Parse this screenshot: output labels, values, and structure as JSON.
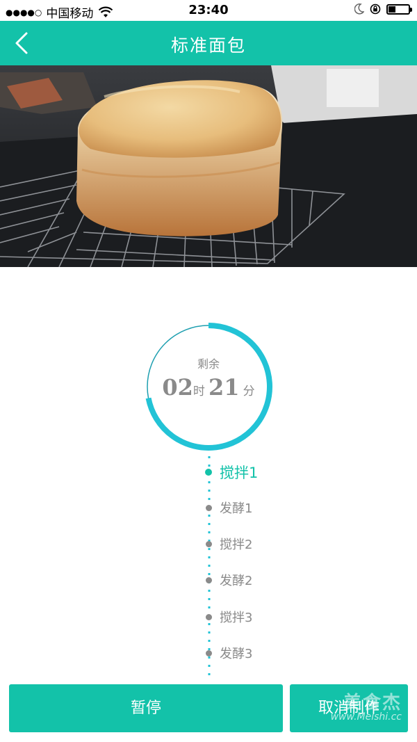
{
  "status_bar": {
    "signal": "●●●●○",
    "carrier": "中国移动",
    "time": "23:40"
  },
  "nav": {
    "title": "标准面包"
  },
  "timer": {
    "label": "剩余",
    "hours": "02",
    "hours_unit": "时",
    "minutes": "21",
    "minutes_unit": "分",
    "progress_fraction": 0.72
  },
  "steps": [
    {
      "label": "搅拌1",
      "active": true
    },
    {
      "label": "发酵1",
      "active": false
    },
    {
      "label": "搅拌2",
      "active": false
    },
    {
      "label": "发酵2",
      "active": false
    },
    {
      "label": "搅拌3",
      "active": false
    },
    {
      "label": "发酵3",
      "active": false
    }
  ],
  "buttons": {
    "pause": "暂停",
    "cancel": "取消制作"
  },
  "watermark": {
    "brand": "美食杰",
    "site": "www.Meishi.cc"
  },
  "colors": {
    "accent": "#13c2a9",
    "timer_ring": "#22c3d6",
    "inactive_text": "#8a8a8a"
  }
}
